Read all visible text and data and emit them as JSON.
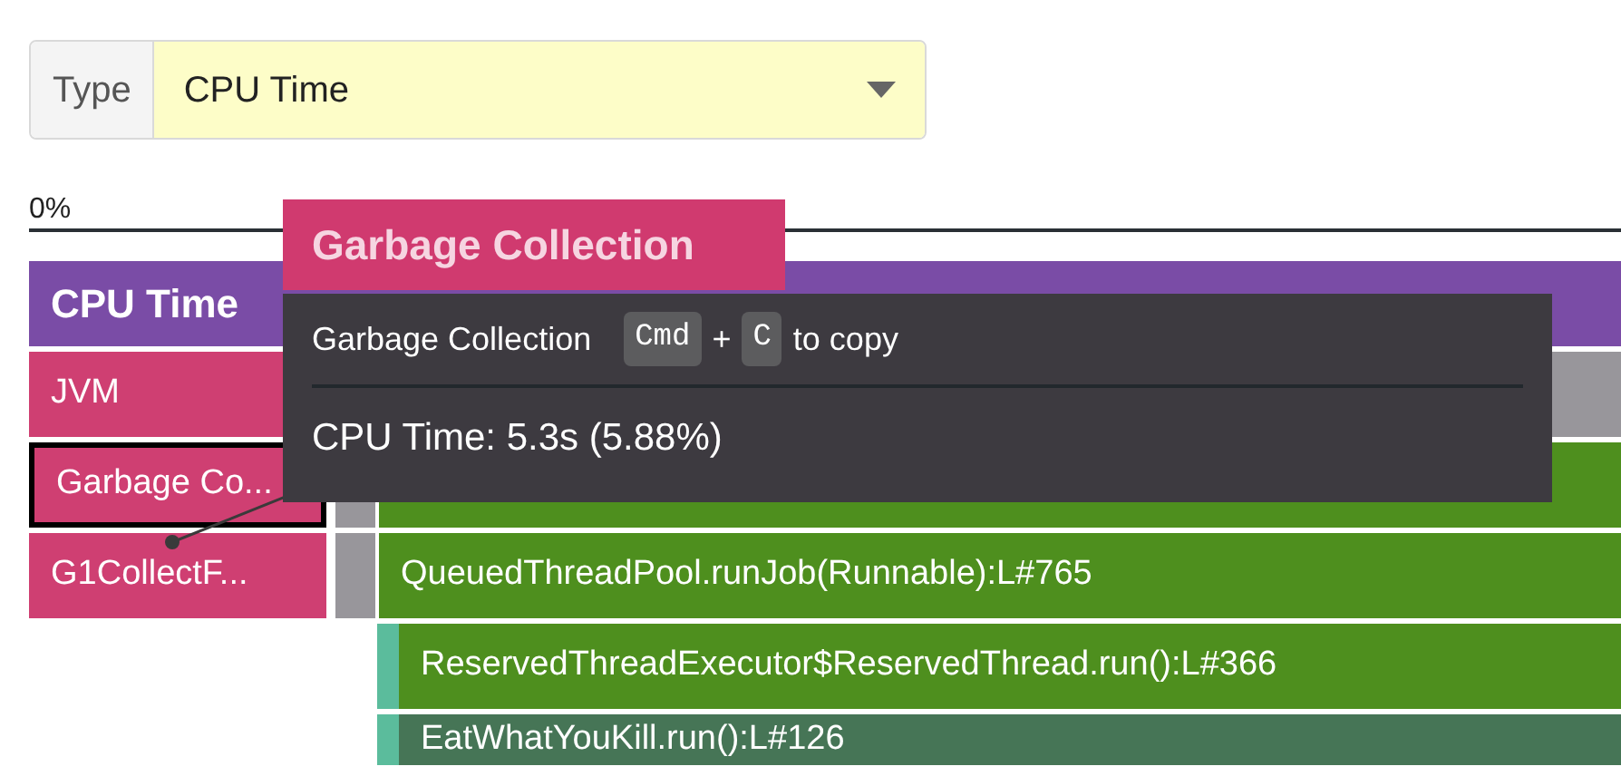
{
  "type_select": {
    "label": "Type",
    "value": "CPU Time"
  },
  "axis": {
    "start_label": "0%"
  },
  "header": {
    "title": "CPU Time",
    "color": "#7a4ca6"
  },
  "rows": [
    {
      "frames": [
        {
          "kind": "leaf",
          "label": "JVM",
          "color": "#cf3f72",
          "selected": false
        },
        {
          "kind": "wide",
          "color": "#98969b"
        }
      ]
    },
    {
      "frames": [
        {
          "kind": "leaf",
          "label": "Garbage Co...",
          "color": "#cf3f72",
          "selected": true
        },
        {
          "kind": "strip",
          "color": "#98969b"
        },
        {
          "kind": "main",
          "color": "#4e8f1e"
        }
      ]
    },
    {
      "frames": [
        {
          "kind": "leaf",
          "label": "G1CollectF...",
          "color": "#cf3f72",
          "selected": false
        },
        {
          "kind": "strip",
          "color": "#98969b"
        },
        {
          "kind": "main",
          "label": "QueuedThreadPool.runJob(Runnable):L#765",
          "color": "#4e8f1e"
        }
      ]
    },
    {
      "frames": [
        {
          "kind": "indent"
        },
        {
          "kind": "narrow",
          "color": "#5bbc9c"
        },
        {
          "kind": "main",
          "label": "ReservedThreadExecutor$ReservedThread.run():L#366",
          "color": "#4e8f1e"
        }
      ]
    },
    {
      "frames": [
        {
          "kind": "indent"
        },
        {
          "kind": "narrow",
          "color": "#5bbc9c"
        },
        {
          "kind": "main",
          "label": "EatWhatYouKill.run():L#126",
          "color": "#467556"
        }
      ]
    }
  ],
  "tooltip": {
    "title": "Garbage Collection",
    "name": "Garbage Collection",
    "keys": [
      "Cmd",
      "C"
    ],
    "joiner": "+",
    "suffix": "to copy",
    "value": "CPU Time: 5.3s (5.88%)"
  }
}
